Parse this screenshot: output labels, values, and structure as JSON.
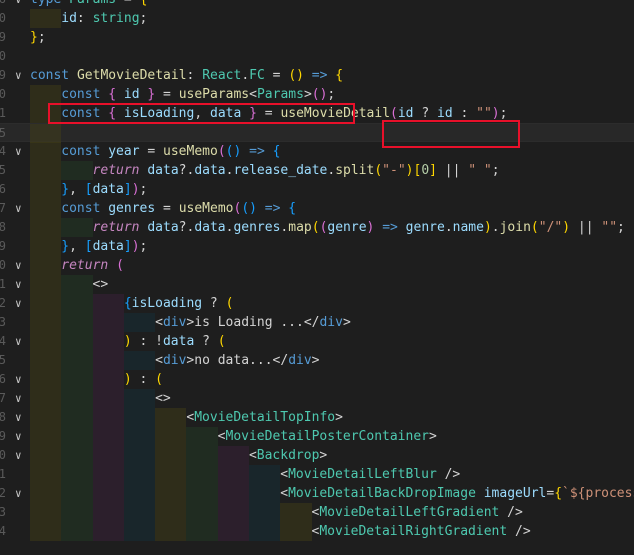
{
  "editor": {
    "lines": [
      {
        "indent": 0,
        "fold": "expanded",
        "gutter": "6",
        "tokens": [
          [
            "kw",
            "type "
          ],
          [
            "typ",
            "Params"
          ],
          [
            "pun",
            " = "
          ],
          [
            "br1",
            "{"
          ]
        ]
      },
      {
        "indent": 1,
        "gutter": "0",
        "tokens": [
          [
            "var",
            "id"
          ],
          [
            "pun",
            ": "
          ],
          [
            "typ",
            "string"
          ],
          [
            "pun",
            ";"
          ]
        ]
      },
      {
        "indent": 0,
        "gutter": "9",
        "tokens": [
          [
            "br1",
            "}"
          ],
          [
            "pun",
            ";"
          ]
        ]
      },
      {
        "indent": 0,
        "gutter": "0",
        "tokens": []
      },
      {
        "indent": 0,
        "fold": "expanded",
        "gutter": "9",
        "tokens": [
          [
            "kw",
            "const "
          ],
          [
            "fn",
            "GetMovieDetail"
          ],
          [
            "pun",
            ": "
          ],
          [
            "typ",
            "React"
          ],
          [
            "pun",
            "."
          ],
          [
            "typ",
            "FC"
          ],
          [
            "pun",
            " = "
          ],
          [
            "br1",
            "()"
          ],
          [
            "pun",
            " "
          ],
          [
            "kw",
            "=>"
          ],
          [
            "pun",
            " "
          ],
          [
            "br1",
            "{"
          ]
        ]
      },
      {
        "indent": 1,
        "gutter": "0",
        "tokens": [
          [
            "kw",
            "const "
          ],
          [
            "br2",
            "{ "
          ],
          [
            "var",
            "id"
          ],
          [
            "br2",
            " }"
          ],
          [
            "pun",
            " = "
          ],
          [
            "fn",
            "useParams"
          ],
          [
            "pun",
            "<"
          ],
          [
            "typ",
            "Params"
          ],
          [
            "pun",
            ">"
          ],
          [
            "br2",
            "()"
          ],
          [
            "pun",
            ";"
          ]
        ]
      },
      {
        "indent": 1,
        "gutter": "1",
        "tokens": [
          [
            "kw",
            "const "
          ],
          [
            "br2",
            "{ "
          ],
          [
            "var",
            "isLoading"
          ],
          [
            "pun",
            ", "
          ],
          [
            "var",
            "data"
          ],
          [
            "br2",
            " }"
          ],
          [
            "pun",
            " = "
          ],
          [
            "fn",
            "useMovieDetail"
          ],
          [
            "br2",
            "("
          ],
          [
            "var",
            "id"
          ],
          [
            "pun",
            " ? "
          ],
          [
            "var",
            "id"
          ],
          [
            "pun",
            " : "
          ],
          [
            "str",
            "\"\""
          ],
          [
            "br2",
            ")"
          ],
          [
            "pun",
            ";"
          ]
        ]
      },
      {
        "indent": 1,
        "gutter": "5",
        "current": true,
        "tokens": []
      },
      {
        "indent": 1,
        "fold": "expanded",
        "gutter": "4",
        "tokens": [
          [
            "kw",
            "const "
          ],
          [
            "var",
            "year"
          ],
          [
            "pun",
            " = "
          ],
          [
            "fn",
            "useMemo"
          ],
          [
            "br2",
            "("
          ],
          [
            "br3",
            "()"
          ],
          [
            "pun",
            " "
          ],
          [
            "kw",
            "=>"
          ],
          [
            "pun",
            " "
          ],
          [
            "br3",
            "{"
          ]
        ]
      },
      {
        "indent": 2,
        "gutter": "5",
        "tokens": [
          [
            "ctl",
            "return "
          ],
          [
            "var",
            "data"
          ],
          [
            "pun",
            "?."
          ],
          [
            "var",
            "data"
          ],
          [
            "pun",
            "."
          ],
          [
            "var",
            "release_date"
          ],
          [
            "pun",
            "."
          ],
          [
            "fn",
            "split"
          ],
          [
            "br1",
            "("
          ],
          [
            "str",
            "\"-\""
          ],
          [
            "br1",
            ")"
          ],
          [
            "br1",
            "["
          ],
          [
            "num",
            "0"
          ],
          [
            "br1",
            "]"
          ],
          [
            "pun",
            " || "
          ],
          [
            "str",
            "\" \""
          ],
          [
            "pun",
            ";"
          ]
        ]
      },
      {
        "indent": 1,
        "gutter": "6",
        "tokens": [
          [
            "br3",
            "}"
          ],
          [
            "pun",
            ", "
          ],
          [
            "br3",
            "["
          ],
          [
            "var",
            "data"
          ],
          [
            "br3",
            "]"
          ],
          [
            "br2",
            ")"
          ],
          [
            "pun",
            ";"
          ]
        ]
      },
      {
        "indent": 1,
        "fold": "expanded",
        "gutter": "7",
        "tokens": [
          [
            "kw",
            "const "
          ],
          [
            "var",
            "genres"
          ],
          [
            "pun",
            " = "
          ],
          [
            "fn",
            "useMemo"
          ],
          [
            "br2",
            "("
          ],
          [
            "br3",
            "()"
          ],
          [
            "pun",
            " "
          ],
          [
            "kw",
            "=>"
          ],
          [
            "pun",
            " "
          ],
          [
            "br3",
            "{"
          ]
        ]
      },
      {
        "indent": 2,
        "gutter": "8",
        "tokens": [
          [
            "ctl",
            "return "
          ],
          [
            "var",
            "data"
          ],
          [
            "pun",
            "?."
          ],
          [
            "var",
            "data"
          ],
          [
            "pun",
            "."
          ],
          [
            "var",
            "genres"
          ],
          [
            "pun",
            "."
          ],
          [
            "fn",
            "map"
          ],
          [
            "br1",
            "("
          ],
          [
            "br2",
            "("
          ],
          [
            "var",
            "genre"
          ],
          [
            "br2",
            ")"
          ],
          [
            "pun",
            " "
          ],
          [
            "kw",
            "=>"
          ],
          [
            "pun",
            " "
          ],
          [
            "var",
            "genre"
          ],
          [
            "pun",
            "."
          ],
          [
            "var",
            "name"
          ],
          [
            "br1",
            ")"
          ],
          [
            "pun",
            "."
          ],
          [
            "fn",
            "join"
          ],
          [
            "br1",
            "("
          ],
          [
            "str",
            "\"/\""
          ],
          [
            "br1",
            ")"
          ],
          [
            "pun",
            " || "
          ],
          [
            "str",
            "\"\""
          ],
          [
            "pun",
            ";"
          ]
        ]
      },
      {
        "indent": 1,
        "gutter": "9",
        "tokens": [
          [
            "br3",
            "}"
          ],
          [
            "pun",
            ", "
          ],
          [
            "br3",
            "["
          ],
          [
            "var",
            "data"
          ],
          [
            "br3",
            "]"
          ],
          [
            "br2",
            ")"
          ],
          [
            "pun",
            ";"
          ]
        ]
      },
      {
        "indent": 1,
        "fold": "expanded",
        "gutter": "0",
        "tokens": [
          [
            "ctl",
            "return "
          ],
          [
            "br2",
            "("
          ]
        ]
      },
      {
        "indent": 2,
        "fold": "expanded",
        "gutter": "1",
        "tokens": [
          [
            "pun",
            "<>"
          ]
        ]
      },
      {
        "indent": 3,
        "fold": "expanded",
        "gutter": "2",
        "tokens": [
          [
            "br3",
            "{"
          ],
          [
            "var",
            "isLoading"
          ],
          [
            "pun",
            " ? "
          ],
          [
            "br1",
            "("
          ]
        ]
      },
      {
        "indent": 4,
        "gutter": "3",
        "tokens": [
          [
            "pun",
            "<"
          ],
          [
            "tag",
            "div"
          ],
          [
            "pun",
            ">"
          ],
          [
            "pun",
            "is Loading ..."
          ],
          [
            "pun",
            "</"
          ],
          [
            "tag",
            "div"
          ],
          [
            "pun",
            ">"
          ]
        ]
      },
      {
        "indent": 3,
        "fold": "expanded",
        "gutter": "4",
        "tokens": [
          [
            "br1",
            ")"
          ],
          [
            "pun",
            " : !"
          ],
          [
            "var",
            "data"
          ],
          [
            "pun",
            " ? "
          ],
          [
            "br1",
            "("
          ]
        ]
      },
      {
        "indent": 4,
        "gutter": "5",
        "tokens": [
          [
            "pun",
            "<"
          ],
          [
            "tag",
            "div"
          ],
          [
            "pun",
            ">"
          ],
          [
            "pun",
            "no data..."
          ],
          [
            "pun",
            "</"
          ],
          [
            "tag",
            "div"
          ],
          [
            "pun",
            ">"
          ]
        ]
      },
      {
        "indent": 3,
        "fold": "expanded",
        "gutter": "6",
        "tokens": [
          [
            "br1",
            ")"
          ],
          [
            "pun",
            " : "
          ],
          [
            "br1",
            "("
          ]
        ]
      },
      {
        "indent": 4,
        "fold": "expanded",
        "gutter": "7",
        "tokens": [
          [
            "pun",
            "<>"
          ]
        ]
      },
      {
        "indent": 5,
        "fold": "expanded",
        "gutter": "8",
        "tokens": [
          [
            "pun",
            "<"
          ],
          [
            "comp",
            "MovieDetailTopInfo"
          ],
          [
            "pun",
            ">"
          ]
        ]
      },
      {
        "indent": 6,
        "fold": "expanded",
        "gutter": "9",
        "tokens": [
          [
            "pun",
            "<"
          ],
          [
            "comp",
            "MovieDetailPosterContainer"
          ],
          [
            "pun",
            ">"
          ]
        ]
      },
      {
        "indent": 7,
        "fold": "expanded",
        "gutter": "0",
        "tokens": [
          [
            "pun",
            "<"
          ],
          [
            "comp",
            "Backdrop"
          ],
          [
            "pun",
            ">"
          ]
        ]
      },
      {
        "indent": 8,
        "gutter": "1",
        "tokens": [
          [
            "pun",
            "<"
          ],
          [
            "comp",
            "MovieDetailLeftBlur"
          ],
          [
            "pun",
            " />"
          ]
        ]
      },
      {
        "indent": 8,
        "fold": "expanded",
        "gutter": "2",
        "tokens": [
          [
            "pun",
            "<"
          ],
          [
            "comp",
            "MovieDetailBackDropImage"
          ],
          [
            "pun",
            " "
          ],
          [
            "attr",
            "imageUrl"
          ],
          [
            "pun",
            "="
          ],
          [
            "br1",
            "{"
          ],
          [
            "str",
            "`${process.e"
          ]
        ]
      },
      {
        "indent": 9,
        "gutter": "3",
        "tokens": [
          [
            "pun",
            "<"
          ],
          [
            "comp",
            "MovieDetailLeftGradient"
          ],
          [
            "pun",
            " />"
          ]
        ]
      },
      {
        "indent": 9,
        "gutter": "4",
        "tokens": [
          [
            "pun",
            "<"
          ],
          [
            "comp",
            "MovieDetailRightGradient"
          ],
          [
            "pun",
            " />"
          ]
        ]
      }
    ]
  },
  "annotations": [
    {
      "label": "highlight-use-params"
    },
    {
      "label": "highlight-id-ternary"
    }
  ]
}
